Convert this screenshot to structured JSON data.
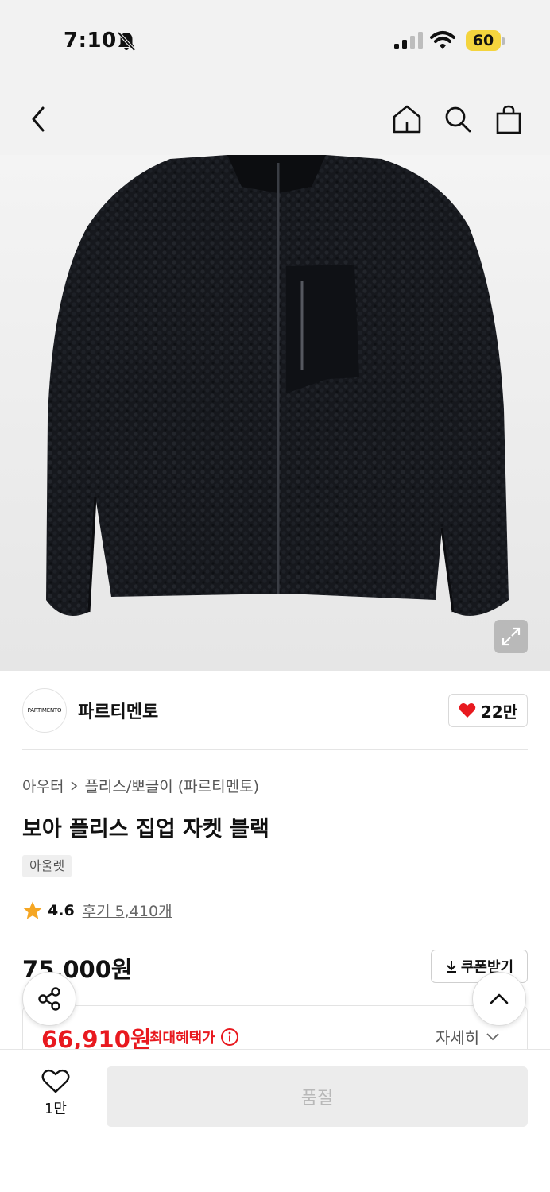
{
  "status_bar": {
    "time": "7:10",
    "battery": "60",
    "icons": [
      "bell-slash-icon",
      "signal-icon",
      "wifi-icon",
      "battery-icon"
    ]
  },
  "nav": {
    "icons": [
      "back-icon",
      "home-icon",
      "search-icon",
      "bag-icon"
    ]
  },
  "brand": {
    "logo_text": "PARTIMENTO",
    "name": "파르티멘토",
    "likes": "22만"
  },
  "category": {
    "primary": "아우터",
    "secondary": "플리스/뽀글이 (파르티멘토)"
  },
  "product": {
    "title": "보아 플리스 집업 자켓 블랙",
    "tag": "아울렛",
    "rating": "4.6",
    "reviews": "후기 5,410개"
  },
  "price": {
    "original": "75,000원",
    "coupon_label": "쿠폰받기",
    "sale": "66,910원",
    "benefit_label": "최대혜택가",
    "detail_label": "자세히"
  },
  "bottom": {
    "wish_count": "1만",
    "buy_label": "품절"
  },
  "colors": {
    "accent_red": "#e8191f",
    "heart_red": "#e8191f",
    "star": "#f5a623"
  }
}
